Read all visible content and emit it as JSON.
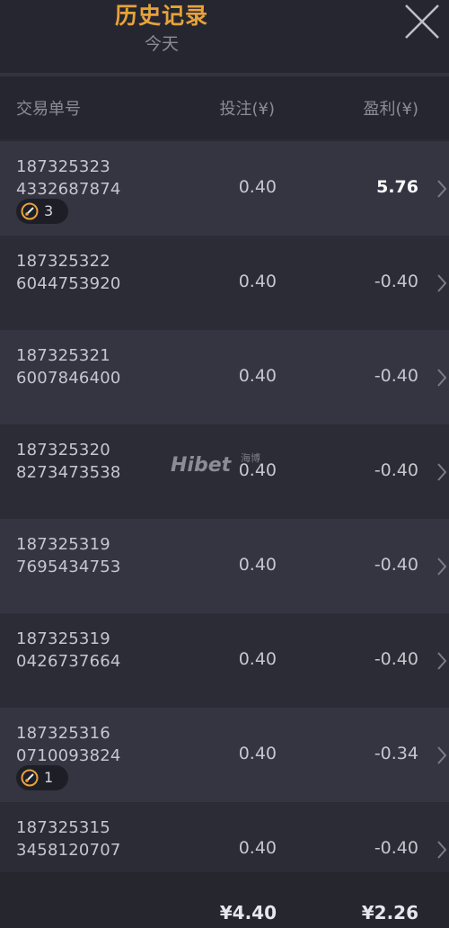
{
  "header": {
    "title": "历史记录",
    "subtitle": "今天"
  },
  "columns": {
    "order_id": "交易单号",
    "bet": "投注(¥)",
    "profit": "盈利(¥)"
  },
  "rows": [
    {
      "id_line1": "187325323",
      "id_line2": "4332687874",
      "bet": "0.40",
      "profit": "5.76",
      "badge": "3"
    },
    {
      "id_line1": "187325322",
      "id_line2": "6044753920",
      "bet": "0.40",
      "profit": "-0.40",
      "badge": null
    },
    {
      "id_line1": "187325321",
      "id_line2": "6007846400",
      "bet": "0.40",
      "profit": "-0.40",
      "badge": null
    },
    {
      "id_line1": "187325320",
      "id_line2": "8273473538",
      "bet": "0.40",
      "profit": "-0.40",
      "badge": null
    },
    {
      "id_line1": "187325319",
      "id_line2": "7695434753",
      "bet": "0.40",
      "profit": "-0.40",
      "badge": null
    },
    {
      "id_line1": "187325319",
      "id_line2": "0426737664",
      "bet": "0.40",
      "profit": "-0.40",
      "badge": null
    },
    {
      "id_line1": "187325316",
      "id_line2": "0710093824",
      "bet": "0.40",
      "profit": "-0.34",
      "badge": "1"
    },
    {
      "id_line1": "187325315",
      "id_line2": "3458120707",
      "bet": "0.40",
      "profit": "-0.40",
      "badge": null
    }
  ],
  "footer": {
    "total_bet": "¥4.40",
    "total_profit": "¥2.26"
  },
  "watermark": {
    "text": "Hibet",
    "sub": "海博"
  },
  "colors": {
    "accent": "#e8a23a",
    "background": "#2a2a33",
    "row_odd": "#353542",
    "row_even": "#2c2c37"
  },
  "icons": {
    "close": "close-icon",
    "chevron": "chevron-right-icon",
    "badge": "free-spin-icon"
  }
}
